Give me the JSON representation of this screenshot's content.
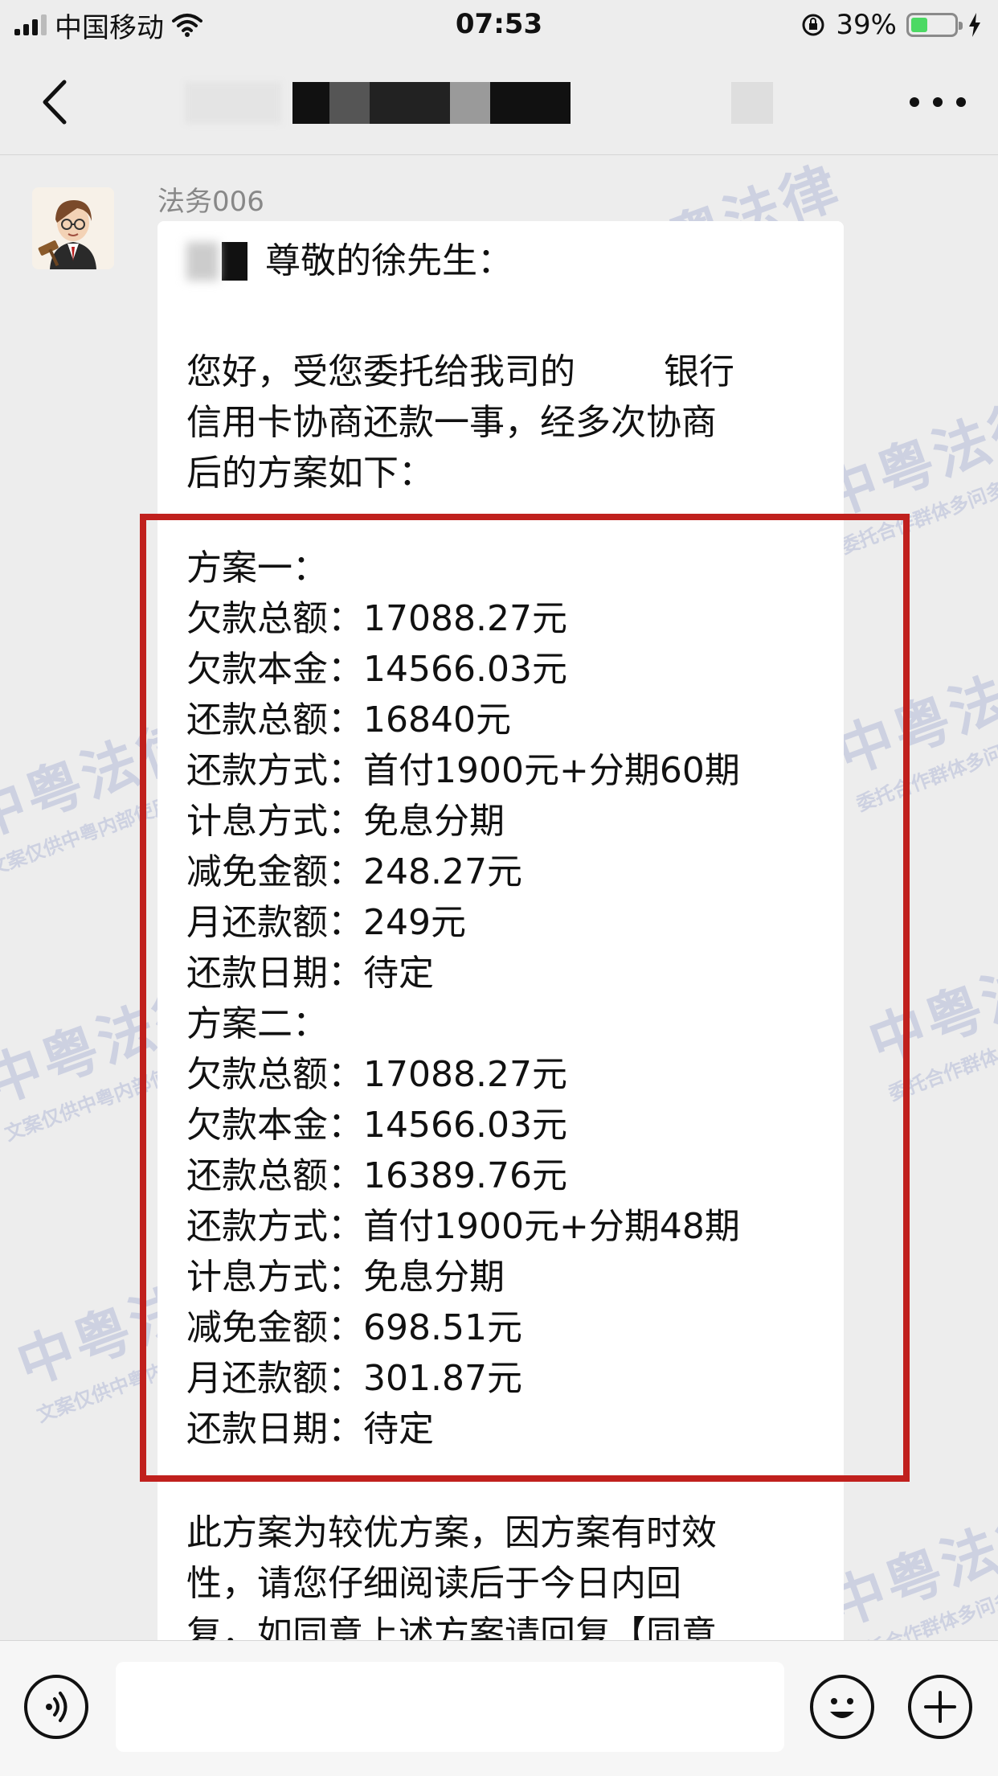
{
  "status_bar": {
    "carrier": "中国移动",
    "time": "07:53",
    "battery_percent": "39%",
    "battery_level": 0.39
  },
  "nav": {
    "title_visible": "",
    "icons": {
      "back": "chevron-left-icon",
      "more": "ellipsis-icon"
    }
  },
  "message": {
    "sender": "法务006",
    "salutation": "尊敬的徐先生：",
    "intro_part1": "您好，受您委托给我司的",
    "intro_part2": "银行",
    "intro_line2": "信用卡协商还款一事，经多次协商",
    "intro_line3": "后的方案如下：",
    "plans": [
      {
        "title": "方案一：",
        "rows": [
          "欠款总额：17088.27元",
          "欠款本金：14566.03元",
          "还款总额：16840元",
          "还款方式：首付1900元+分期60期",
          "计息方式：免息分期",
          "减免金额：248.27元",
          "月还款额：249元",
          "还款日期：待定"
        ]
      },
      {
        "title": "方案二：",
        "rows": [
          "欠款总额：17088.27元",
          "欠款本金：14566.03元",
          "还款总额：16389.76元",
          "还款方式：首付1900元+分期48期",
          "计息方式：免息分期",
          "减免金额：698.51元",
          "月还款额：301.87元",
          "还款日期：待定"
        ]
      }
    ],
    "closing_line1": "此方案为较优方案，因方案有时效",
    "closing_line2": "性，请您仔细阅读后于今日内回",
    "closing_line3": "复，如同意上述方案请回复【同意"
  },
  "watermark": {
    "main": "中粤法律",
    "sub1": "文案仅供中粤内部使用",
    "sub2": "委托合作群体多问多核实"
  },
  "input_bar": {
    "placeholder": "",
    "icons": {
      "voice": "voice-icon",
      "emoji": "emoji-icon",
      "add": "plus-icon"
    }
  },
  "colors": {
    "highlight_border": "#c0201d",
    "battery_fill": "#4cd964",
    "background": "#ededed"
  }
}
